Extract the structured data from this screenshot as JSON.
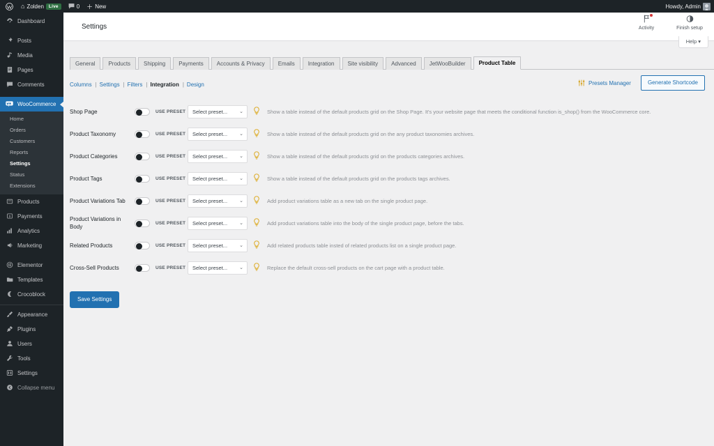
{
  "adminbar": {
    "logo_icon": "wordpress-logo-icon",
    "site_icon": "home-icon",
    "site_name": "Zolden",
    "live_badge": "Live",
    "comments_icon": "comment-icon",
    "comments_count": "0",
    "new_icon": "plus-icon",
    "new_label": "New",
    "howdy": "Howdy, Admin",
    "avatar": "user-avatar"
  },
  "sidebar": {
    "items": [
      {
        "label": "Dashboard",
        "icon": "dashboard-icon",
        "active": false
      },
      {
        "label": "Posts",
        "icon": "pin-icon",
        "active": false
      },
      {
        "label": "Media",
        "icon": "media-icon",
        "active": false
      },
      {
        "label": "Pages",
        "icon": "page-icon",
        "active": false
      },
      {
        "label": "Comments",
        "icon": "comment-icon",
        "active": false
      },
      {
        "label": "WooCommerce",
        "icon": "woocommerce-icon",
        "active": true
      },
      {
        "label": "Products",
        "icon": "products-icon",
        "active": false
      },
      {
        "label": "Payments",
        "icon": "payments-icon",
        "active": false
      },
      {
        "label": "Analytics",
        "icon": "analytics-bars-icon",
        "active": false
      },
      {
        "label": "Marketing",
        "icon": "megaphone-icon",
        "active": false
      },
      {
        "label": "Elementor",
        "icon": "elementor-icon",
        "active": false
      },
      {
        "label": "Templates",
        "icon": "templates-folder-icon",
        "active": false
      },
      {
        "label": "Crocoblock",
        "icon": "crocoblock-moon-icon",
        "active": false
      },
      {
        "label": "Appearance",
        "icon": "brush-icon",
        "active": false
      },
      {
        "label": "Plugins",
        "icon": "plug-icon",
        "active": false
      },
      {
        "label": "Users",
        "icon": "users-icon",
        "active": false
      },
      {
        "label": "Tools",
        "icon": "tools-wrench-icon",
        "active": false
      },
      {
        "label": "Settings",
        "icon": "settings-sliders-icon",
        "active": false
      },
      {
        "label": "Collapse menu",
        "icon": "collapse-arrow-icon",
        "active": false
      }
    ],
    "woo_submenu": [
      {
        "label": "Home",
        "current": false
      },
      {
        "label": "Orders",
        "current": false
      },
      {
        "label": "Customers",
        "current": false
      },
      {
        "label": "Reports",
        "current": false
      },
      {
        "label": "Settings",
        "current": true
      },
      {
        "label": "Status",
        "current": false
      },
      {
        "label": "Extensions",
        "current": false
      }
    ]
  },
  "woo_header": {
    "title": "Settings",
    "actions": [
      {
        "label": "Activity",
        "icon": "flag-activity-icon",
        "has_dot": true
      },
      {
        "label": "Finish setup",
        "icon": "half-circle-progress-icon",
        "has_dot": false
      }
    ],
    "help_tab": "Help",
    "help_caret": "▾"
  },
  "tabs": [
    {
      "label": "General",
      "active": false
    },
    {
      "label": "Products",
      "active": false
    },
    {
      "label": "Shipping",
      "active": false
    },
    {
      "label": "Payments",
      "active": false
    },
    {
      "label": "Accounts & Privacy",
      "active": false
    },
    {
      "label": "Emails",
      "active": false
    },
    {
      "label": "Integration",
      "active": false
    },
    {
      "label": "Site visibility",
      "active": false
    },
    {
      "label": "Advanced",
      "active": false
    },
    {
      "label": "JetWooBuilder",
      "active": false
    },
    {
      "label": "Product Table",
      "active": true
    }
  ],
  "subnav": {
    "links": [
      {
        "label": "Columns",
        "current": false
      },
      {
        "label": "Settings",
        "current": false
      },
      {
        "label": "Filters",
        "current": false
      },
      {
        "label": "Integration",
        "current": true
      },
      {
        "label": "Design",
        "current": false
      }
    ],
    "separator": "|",
    "presets_manager": {
      "label": "Presets Manager",
      "icon": "sliders-icon"
    },
    "generate_shortcode": "Generate Shortcode"
  },
  "settings": {
    "use_preset_label": "USE PRESET",
    "select_placeholder": "Select preset...",
    "caret": "⌄",
    "bulb_icon": "lightbulb-icon",
    "rows": [
      {
        "label": "Shop Page",
        "enabled": false,
        "preset": "Select preset...",
        "description": "Show a table instead of the default products grid on the Shop Page. It's your website page that meets the conditional function is_shop() from the WooCommerce core."
      },
      {
        "label": "Product Taxonomy",
        "enabled": false,
        "preset": "Select preset...",
        "description": "Show a table instead of the default products grid on the any product taxonomies archives."
      },
      {
        "label": "Product Categories",
        "enabled": false,
        "preset": "Select preset...",
        "description": "Show a table instead of the default products grid on the products categories archives."
      },
      {
        "label": "Product Tags",
        "enabled": false,
        "preset": "Select preset...",
        "description": "Show a table instead of the default products grid on the products tags archives."
      },
      {
        "label": "Product Variations Tab",
        "enabled": false,
        "preset": "Select preset...",
        "description": "Add product variations table as a new tab on the single product page."
      },
      {
        "label": "Product Variations in Body",
        "enabled": false,
        "preset": "Select preset...",
        "description": "Add product variations table into the body of the single product page, before the tabs."
      },
      {
        "label": "Related Products",
        "enabled": false,
        "preset": "Select preset...",
        "description": "Add related products table insted of related products list on a single product page."
      },
      {
        "label": "Cross-Sell Products",
        "enabled": false,
        "preset": "Select preset...",
        "description": "Replace the default cross-sell products on the cart page with a product table."
      }
    ],
    "save_button": "Save Settings"
  },
  "colors": {
    "admin_dark": "#1d2327",
    "sidebar_submenu": "#2c3338",
    "accent_blue": "#2271b1",
    "page_bg": "#f0f0f1",
    "bulb_amber": "#dba617",
    "live_green": "#2f6f43"
  }
}
